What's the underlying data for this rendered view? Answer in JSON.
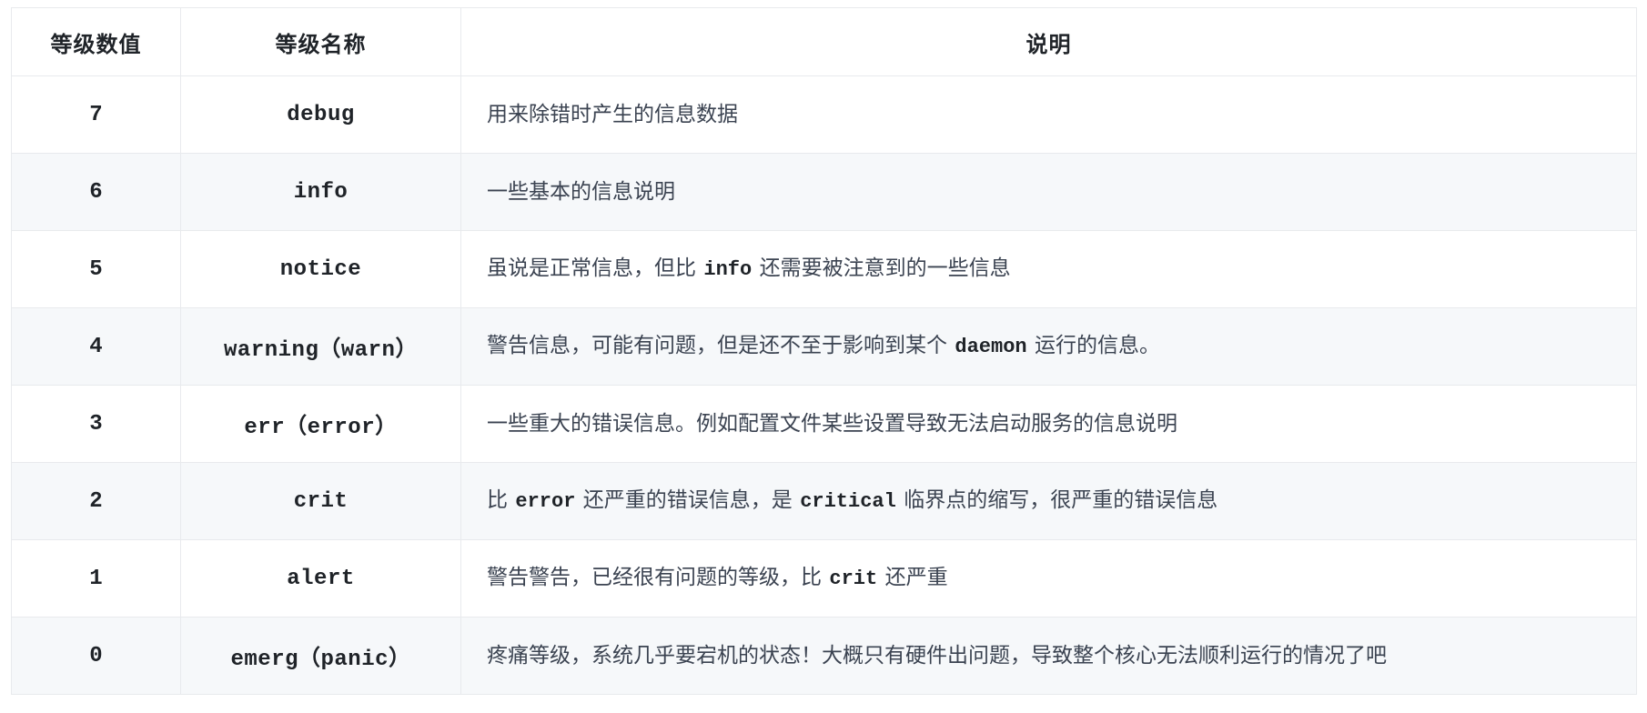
{
  "table": {
    "headers": [
      {
        "label": "等级数值",
        "key": "value"
      },
      {
        "label": "等级名称",
        "key": "name"
      },
      {
        "label": "说明",
        "key": "desc"
      }
    ],
    "rows": [
      {
        "value": "7",
        "name": "debug",
        "desc_plain": "用来除错时产生的信息数据",
        "desc_segments": [
          {
            "type": "text",
            "text": "用来除错时产生的信息数据"
          }
        ]
      },
      {
        "value": "6",
        "name": "info",
        "desc_plain": "一些基本的信息说明",
        "desc_segments": [
          {
            "type": "text",
            "text": "一些基本的信息说明"
          }
        ]
      },
      {
        "value": "5",
        "name": "notice",
        "desc_plain": "虽说是正常信息，但比 info 还需要被注意到的一些信息",
        "desc_segments": [
          {
            "type": "text",
            "text": "虽说是正常信息，但比 "
          },
          {
            "type": "code",
            "text": "info"
          },
          {
            "type": "text",
            "text": " 还需要被注意到的一些信息"
          }
        ]
      },
      {
        "value": "4",
        "name": "warning（warn）",
        "desc_plain": "警告信息，可能有问题，但是还不至于影响到某个 daemon 运行的信息。",
        "desc_segments": [
          {
            "type": "text",
            "text": "警告信息，可能有问题，但是还不至于影响到某个 "
          },
          {
            "type": "code",
            "text": "daemon"
          },
          {
            "type": "text",
            "text": " 运行的信息。"
          }
        ]
      },
      {
        "value": "3",
        "name": "err（error）",
        "desc_plain": "一些重大的错误信息。例如配置文件某些设置导致无法启动服务的信息说明",
        "desc_segments": [
          {
            "type": "text",
            "text": "一些重大的错误信息。例如配置文件某些设置导致无法启动服务的信息说明"
          }
        ]
      },
      {
        "value": "2",
        "name": "crit",
        "desc_plain": "比 error 还严重的错误信息，是 critical 临界点的缩写，很严重的错误信息",
        "desc_segments": [
          {
            "type": "text",
            "text": "比 "
          },
          {
            "type": "code",
            "text": "error"
          },
          {
            "type": "text",
            "text": " 还严重的错误信息，是 "
          },
          {
            "type": "code",
            "text": "critical"
          },
          {
            "type": "text",
            "text": " 临界点的缩写，很严重的错误信息"
          }
        ]
      },
      {
        "value": "1",
        "name": "alert",
        "desc_plain": "警告警告，已经很有问题的等级，比 crit 还严重",
        "desc_segments": [
          {
            "type": "text",
            "text": "警告警告，已经很有问题的等级，比 "
          },
          {
            "type": "code",
            "text": "crit"
          },
          {
            "type": "text",
            "text": " 还严重"
          }
        ]
      },
      {
        "value": "0",
        "name": "emerg（panic）",
        "desc_plain": "疼痛等级，系统几乎要宕机的状态！大概只有硬件出问题，导致整个核心无法顺利运行的情况了吧",
        "desc_segments": [
          {
            "type": "text",
            "text": "疼痛等级，系统几乎要宕机的状态！大概只有硬件出问题，导致整个核心无法顺利运行的情况了吧"
          }
        ]
      }
    ]
  },
  "style": {
    "border_color": "#e8eaed",
    "alt_row_bg": "#f6f8fa",
    "row_bg": "#ffffff",
    "text_color": "#3b4351",
    "heading_color": "#1f2328"
  }
}
